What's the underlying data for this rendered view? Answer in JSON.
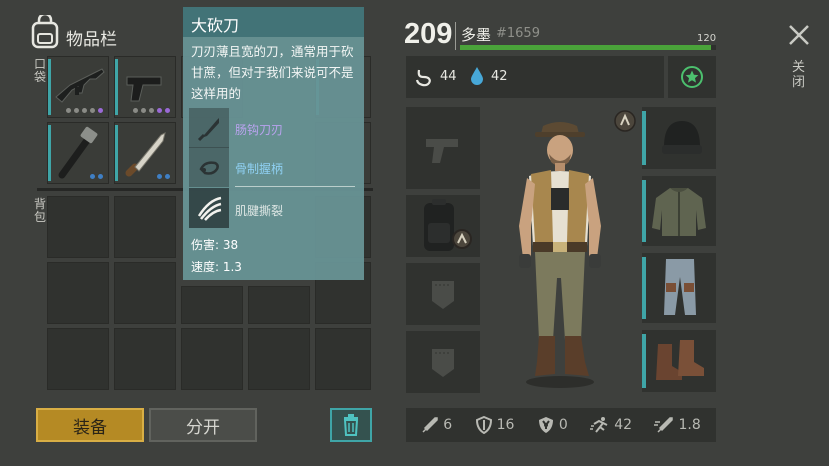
{
  "inventory": {
    "title": "物品栏",
    "pocket_label": "口袋",
    "backpack_label": "背包"
  },
  "tooltip": {
    "title": "大砍刀",
    "description": "刀刃薄且宽的刀，通常用于砍甘蔗，但对于我们来说可不是这样用的",
    "perks": [
      {
        "label": "肠钩刀刃",
        "color": "#b9a3ee",
        "icon": "hook-blade-icon"
      },
      {
        "label": "骨制握柄",
        "color": "#8fd0f2",
        "icon": "bone-handle-icon"
      },
      {
        "label": "肌腱撕裂",
        "color": "#dde6e4",
        "icon": "claw-slash-icon"
      }
    ],
    "damage": "伤害: 38",
    "speed": "速度: 1.3"
  },
  "player": {
    "level": "209",
    "name": "多墨",
    "id": "#1659",
    "xp_max": "120",
    "xp_fraction": 0.98,
    "hunger": "44",
    "thirst": "42"
  },
  "stats": {
    "attack": "6",
    "defense": "16",
    "radiation": "0",
    "speed": "42",
    "attack_speed": "1.8"
  },
  "buttons": {
    "equip": "装备",
    "split": "分开",
    "close": "关闭"
  },
  "colors": {
    "accent_teal": "#3fa5a7",
    "xp_green": "#4aa33a",
    "equip_gold": "#b58a24"
  }
}
